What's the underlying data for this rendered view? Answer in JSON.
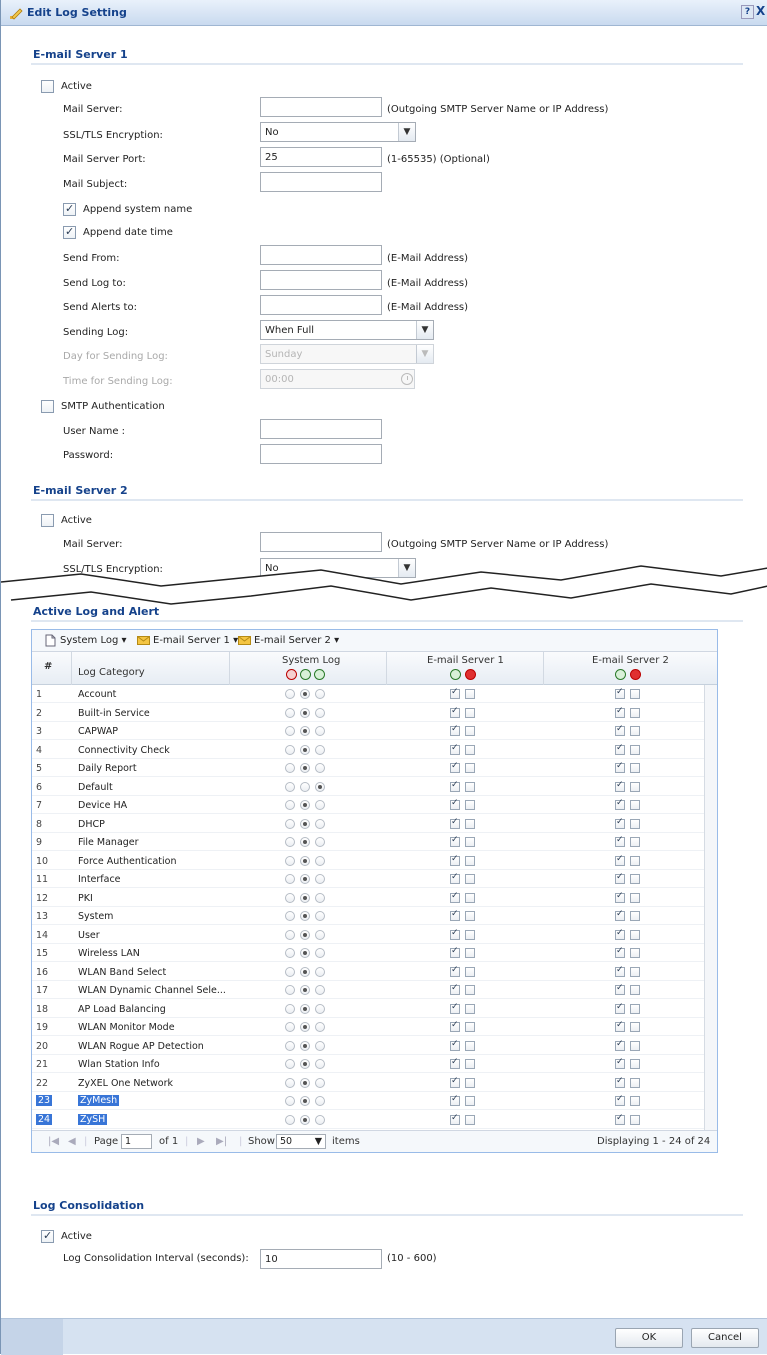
{
  "window": {
    "title": "Edit Log Setting",
    "help": "?",
    "close": "X"
  },
  "server1": {
    "section_title": "E-mail Server 1",
    "active_label": "Active",
    "mail_server_label": "Mail Server:",
    "mail_server_value": "",
    "mail_server_hint": "(Outgoing SMTP Server Name or IP Address)",
    "ssl_label": "SSL/TLS Encryption:",
    "ssl_value": "No",
    "port_label": "Mail Server Port:",
    "port_value": "25",
    "port_hint": "(1-65535) (Optional)",
    "subject_label": "Mail Subject:",
    "subject_value": "",
    "append_name_label": "Append system name",
    "append_date_label": "Append date time",
    "send_from_label": "Send From:",
    "send_from_hint": "(E-Mail Address)",
    "send_log_label": "Send Log to:",
    "send_log_hint": "(E-Mail Address)",
    "send_alerts_label": "Send Alerts to:",
    "send_alerts_hint": "(E-Mail Address)",
    "sending_log_label": "Sending Log:",
    "sending_log_value": "When Full",
    "day_label": "Day for Sending Log:",
    "day_value": "Sunday",
    "time_label": "Time for Sending Log:",
    "time_value": "00:00",
    "smtp_auth_label": "SMTP Authentication",
    "username_label": "User Name :",
    "password_label": "Password:"
  },
  "server2": {
    "section_title": "E-mail Server 2",
    "active_label": "Active",
    "mail_server_label": "Mail Server:",
    "mail_server_hint": "(Outgoing SMTP Server Name or IP Address)",
    "ssl_label": "SSL/TLS Encryption:",
    "ssl_value": "No"
  },
  "alerts": {
    "section_title": "Active Log and Alert",
    "toolbar": {
      "system_log": "System Log",
      "server1": "E-mail Server 1",
      "server2": "E-mail Server 2"
    },
    "headers": {
      "num": "#",
      "category": "Log Category",
      "system_log": "System Log",
      "server1": "E-mail Server 1",
      "server2": "E-mail Server 2"
    },
    "rows": [
      {
        "num": "1",
        "category": "Account",
        "sys": 1,
        "s1": true,
        "s2": true
      },
      {
        "num": "2",
        "category": "Built-in Service",
        "sys": 1,
        "s1": true,
        "s2": true
      },
      {
        "num": "3",
        "category": "CAPWAP",
        "sys": 1,
        "s1": true,
        "s2": true
      },
      {
        "num": "4",
        "category": "Connectivity Check",
        "sys": 1,
        "s1": true,
        "s2": true
      },
      {
        "num": "5",
        "category": "Daily Report",
        "sys": 1,
        "s1": true,
        "s2": true
      },
      {
        "num": "6",
        "category": "Default",
        "sys": 2,
        "s1": true,
        "s2": true
      },
      {
        "num": "7",
        "category": "Device HA",
        "sys": 1,
        "s1": true,
        "s2": true
      },
      {
        "num": "8",
        "category": "DHCP",
        "sys": 1,
        "s1": true,
        "s2": true
      },
      {
        "num": "9",
        "category": "File Manager",
        "sys": 1,
        "s1": true,
        "s2": true
      },
      {
        "num": "10",
        "category": "Force Authentication",
        "sys": 1,
        "s1": true,
        "s2": true
      },
      {
        "num": "11",
        "category": "Interface",
        "sys": 1,
        "s1": true,
        "s2": true
      },
      {
        "num": "12",
        "category": "PKI",
        "sys": 1,
        "s1": true,
        "s2": true
      },
      {
        "num": "13",
        "category": "System",
        "sys": 1,
        "s1": true,
        "s2": true
      },
      {
        "num": "14",
        "category": "User",
        "sys": 1,
        "s1": true,
        "s2": true
      },
      {
        "num": "15",
        "category": "Wireless LAN",
        "sys": 1,
        "s1": true,
        "s2": true
      },
      {
        "num": "16",
        "category": "WLAN Band Select",
        "sys": 1,
        "s1": true,
        "s2": true
      },
      {
        "num": "17",
        "category": "WLAN Dynamic Channel Sele...",
        "sys": 1,
        "s1": true,
        "s2": true
      },
      {
        "num": "18",
        "category": "AP Load Balancing",
        "sys": 1,
        "s1": true,
        "s2": true
      },
      {
        "num": "19",
        "category": "WLAN Monitor Mode",
        "sys": 1,
        "s1": true,
        "s2": true
      },
      {
        "num": "20",
        "category": "WLAN Rogue AP Detection",
        "sys": 1,
        "s1": true,
        "s2": true
      },
      {
        "num": "21",
        "category": "Wlan Station Info",
        "sys": 1,
        "s1": true,
        "s2": true
      },
      {
        "num": "22",
        "category": "ZyXEL One Network",
        "sys": 1,
        "s1": true,
        "s2": true
      },
      {
        "num": "23",
        "category": "ZyMesh",
        "sys": 1,
        "s1": true,
        "s2": true,
        "selected": true
      },
      {
        "num": "24",
        "category": "ZySH",
        "sys": 1,
        "s1": true,
        "s2": true,
        "selected": true
      }
    ],
    "pager": {
      "page_label": "Page",
      "page_value": "1",
      "of_label": "of 1",
      "show_label": "Show",
      "show_value": "50",
      "items_label": "items",
      "displaying": "Displaying 1 - 24 of 24"
    }
  },
  "consolidation": {
    "section_title": "Log Consolidation",
    "active_label": "Active",
    "interval_label": "Log Consolidation Interval (seconds):",
    "interval_value": "10",
    "interval_hint": "(10 - 600)"
  },
  "footer": {
    "ok": "OK",
    "cancel": "Cancel"
  },
  "colors": {
    "title": "#15428b",
    "accent": "#3875d7",
    "footer": "#d6e2f1"
  }
}
